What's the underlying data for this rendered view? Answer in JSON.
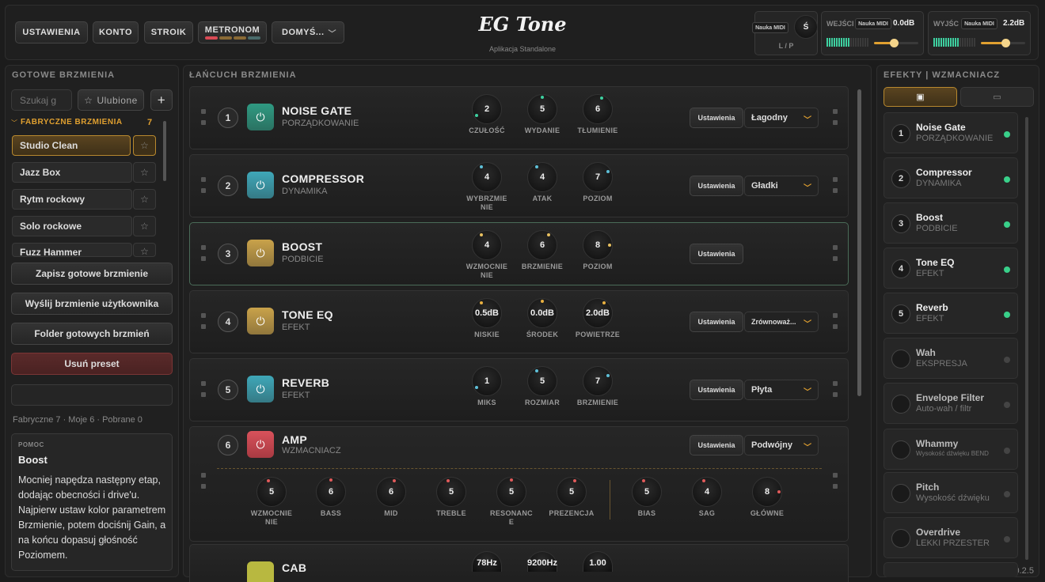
{
  "top": {
    "settings": "USTAWIENIA",
    "account": "KONTO",
    "tuner": "STROIK",
    "metronome": "METRONOM",
    "preset_select": "DOMYŚ...",
    "logo": "EG Tone",
    "subtitle": "Aplikacja Standalone",
    "midi_learn": "Nauka MIDI",
    "midi_knob": "Ś",
    "lr": "L / P",
    "input_label": "WEJŚCI",
    "input_val": "0.0dB",
    "output_label": "WYJŚC",
    "output_val": "2.2dB",
    "input_level": 0.55,
    "output_level": 0.6
  },
  "left": {
    "header": "GOTOWE BRZMIENIA",
    "search_ph": "Szukaj g",
    "favorites": "Ulubione",
    "add": "+",
    "factory": "FABRYCZNE BRZMIENIA",
    "factory_count": "7",
    "presets": [
      "Studio Clean",
      "Jazz Box",
      "Rytm rockowy",
      "Solo rockowe",
      "Fuzz Hammer"
    ],
    "save": "Zapisz gotowe brzmienie",
    "send": "Wyślij brzmienie użytkownika",
    "folder": "Folder gotowych brzmień",
    "delete": "Usuń preset",
    "stats": "Fabryczne 7 · Moje 6 · Pobrane 0",
    "help_tag": "POMOC",
    "help_title": "Boost",
    "help_text": "Mocniej napędza następny etap, dodając obecności i drive'u. Najpierw ustaw kolor parametrem Brzmienie, potem dociśnij Gain, a na końcu dopasuj głośność Poziomem."
  },
  "chain": {
    "header": "ŁAŃCUCH BRZMIENIA",
    "ust": "Ustawienia",
    "items": [
      {
        "n": "1",
        "name": "NOISE GATE",
        "sub": "PORZĄDKOWANIE",
        "dd": "Łagodny",
        "knobs": [
          {
            "v": "2",
            "l": "CZUŁOŚĆ"
          },
          {
            "v": "5",
            "l": "WYDANIE"
          },
          {
            "v": "6",
            "l": "TŁUMIENIE"
          }
        ]
      },
      {
        "n": "2",
        "name": "COMPRESSOR",
        "sub": "DYNAMIKA",
        "dd": "Gładki",
        "knobs": [
          {
            "v": "4",
            "l": "WYBRZMIE NIE"
          },
          {
            "v": "4",
            "l": "ATAK"
          },
          {
            "v": "7",
            "l": "POZIOM"
          }
        ]
      },
      {
        "n": "3",
        "name": "BOOST",
        "sub": "PODBICIE",
        "dd": "",
        "knobs": [
          {
            "v": "4",
            "l": "WZMOCNIE NIE"
          },
          {
            "v": "6",
            "l": "BRZMIENIE"
          },
          {
            "v": "8",
            "l": "POZIOM"
          }
        ]
      },
      {
        "n": "4",
        "name": "TONE EQ",
        "sub": "EFEKT",
        "dd": "Zrównoważ...",
        "knobs": [
          {
            "v": "0.5dB",
            "l": "NISKIE"
          },
          {
            "v": "0.0dB",
            "l": "ŚRODEK"
          },
          {
            "v": "2.0dB",
            "l": "POWIETRZE"
          }
        ]
      },
      {
        "n": "5",
        "name": "REVERB",
        "sub": "EFEKT",
        "dd": "Płyta",
        "knobs": [
          {
            "v": "1",
            "l": "MIKS"
          },
          {
            "v": "5",
            "l": "ROZMIAR"
          },
          {
            "v": "7",
            "l": "BRZMIENIE"
          }
        ]
      }
    ],
    "amp": {
      "n": "6",
      "name": "AMP",
      "sub": "WZMACNIACZ",
      "dd": "Podwójny",
      "knobs": [
        {
          "v": "5",
          "l": "WZMOCNIE NIE"
        },
        {
          "v": "6",
          "l": "BASS"
        },
        {
          "v": "6",
          "l": "MID"
        },
        {
          "v": "5",
          "l": "TREBLE"
        },
        {
          "v": "5",
          "l": "RESONANC E"
        },
        {
          "v": "5",
          "l": "PREZENCJA"
        },
        {
          "v": "5",
          "l": "BIAS"
        },
        {
          "v": "4",
          "l": "SAG"
        },
        {
          "v": "8",
          "l": "GŁÓWNE"
        }
      ]
    },
    "cab": {
      "name": "CAB",
      "knobs": [
        "78Hz",
        "9200Hz",
        "1.00"
      ]
    }
  },
  "right": {
    "header": "EFEKTY | WZMACNIACZ",
    "version": "v0.2.5",
    "items": [
      {
        "n": "1",
        "t": "Noise Gate",
        "s": "PORZĄDKOWANIE",
        "on": true
      },
      {
        "n": "2",
        "t": "Compressor",
        "s": "DYNAMIKA",
        "on": true
      },
      {
        "n": "3",
        "t": "Boost",
        "s": "PODBICIE",
        "on": true
      },
      {
        "n": "4",
        "t": "Tone EQ",
        "s": "EFEKT",
        "on": true
      },
      {
        "n": "5",
        "t": "Reverb",
        "s": "EFEKT",
        "on": true
      },
      {
        "n": "",
        "t": "Wah",
        "s": "EKSPRESJA",
        "on": false
      },
      {
        "n": "",
        "t": "Envelope Filter",
        "s": "Auto-wah / filtr",
        "on": false
      },
      {
        "n": "",
        "t": "Whammy",
        "s": "Wysokość dźwięku BEND",
        "on": false
      },
      {
        "n": "",
        "t": "Pitch",
        "s": "Wysokość dźwięku",
        "on": false
      },
      {
        "n": "",
        "t": "Overdrive",
        "s": "LEKKI PRZESTER",
        "on": false
      }
    ]
  }
}
